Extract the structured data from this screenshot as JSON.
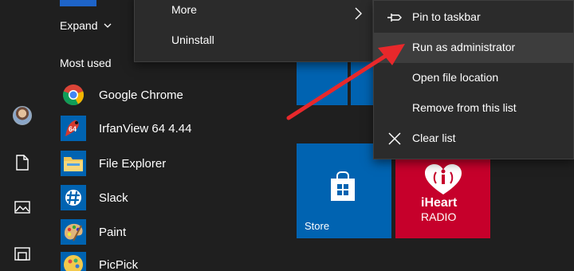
{
  "applist": {
    "expand_label": "Expand",
    "section_title": "Most used",
    "apps": [
      {
        "label": "Google Chrome",
        "icon": "chrome-icon"
      },
      {
        "label": "IrfanView 64 4.44",
        "icon": "irfanview-icon"
      },
      {
        "label": "File Explorer",
        "icon": "folder-icon"
      },
      {
        "label": "Slack",
        "icon": "slack-icon"
      },
      {
        "label": "Paint",
        "icon": "paint-palette-icon"
      },
      {
        "label": "PicPick",
        "icon": "picpick-icon"
      }
    ],
    "irfanview_badge": "64"
  },
  "context_menu": {
    "more_label": "More",
    "uninstall_label": "Uninstall"
  },
  "submenu": {
    "items": [
      {
        "label": "Pin to taskbar",
        "icon": "pin-icon"
      },
      {
        "label": "Run as administrator",
        "icon": ""
      },
      {
        "label": "Open file location",
        "icon": ""
      },
      {
        "label": "Remove from this list",
        "icon": ""
      },
      {
        "label": "Clear list",
        "icon": "close-icon"
      }
    ]
  },
  "tiles": {
    "store_label": "Store",
    "iheart_brand": "iHeart",
    "iheart_sub": "RADIO"
  },
  "colors": {
    "accent": "#0063b1",
    "iheart": "#c6002b",
    "annotation_arrow": "#e8282b",
    "menu_bg": "#2b2b2b",
    "highlight": "#3d3d3d"
  }
}
